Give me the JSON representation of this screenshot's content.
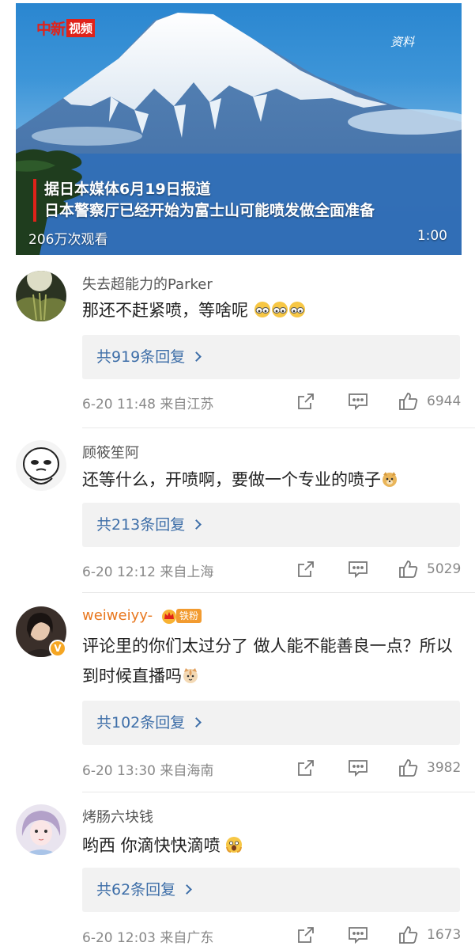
{
  "video": {
    "logo_text": "中新",
    "logo_box": "视频",
    "source_tag": "资料",
    "caption_line1": "据日本媒体6月19日报道",
    "caption_line2": "日本警察厅已经开始为富士山可能喷发做全面准备",
    "view_count": "206万次观看",
    "duration": "1:00"
  },
  "comments": [
    {
      "username": "失去超能力的Parker",
      "text": "那还不赶紧喷，等啥呢",
      "emoji": "eyes-emoji x3",
      "replies": "共919条回复",
      "meta": "6-20 11:48 来自江苏",
      "likes": "6944"
    },
    {
      "username": "顾筱笙阿",
      "text": "还等什么，开喷啊，要做一个专业的喷子",
      "emoji": "doge-emoji",
      "replies": "共213条回复",
      "meta": "6-20 12:12 来自上海",
      "likes": "5029"
    },
    {
      "username": "weiweiyy-",
      "fan_badge": "铁粉",
      "verified": "V",
      "text": "评论里的你们太过分了 做人能不能善良一点？所以到时候直播吗",
      "emoji": "cat-emoji",
      "replies": "共102条回复",
      "meta": "6-20 13:30 来自海南",
      "likes": "3982"
    },
    {
      "username": "烤肠六块钱",
      "text": "哟西 你滴快快滴喷",
      "emoji": "scared-emoji",
      "replies": "共62条回复",
      "meta": "6-20 12:03 来自广东",
      "likes": "1673"
    }
  ],
  "colors": {
    "link_blue": "#3d6ea8",
    "vip_orange": "#e8771e",
    "meta_gray": "#888888",
    "reply_bg": "#f2f2f2"
  },
  "icons": {
    "share": "share-icon",
    "comment": "comment-icon",
    "like": "thumbs-up-icon"
  }
}
